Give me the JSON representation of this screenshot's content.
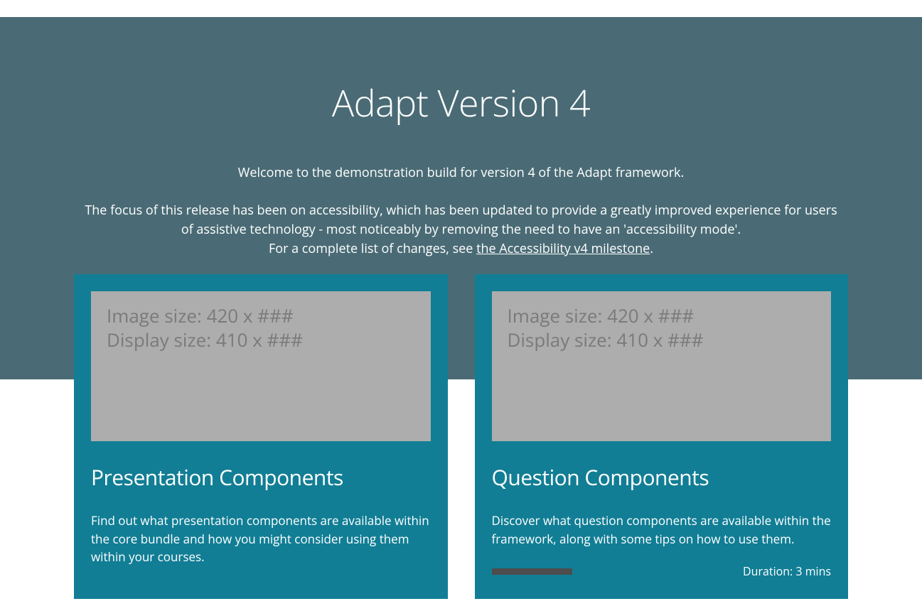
{
  "hero": {
    "title": "Adapt Version 4",
    "intro": "Welcome to the demonstration build for version 4 of the Adapt framework.",
    "body_line1": "The focus of this release has been on accessibility, which has been updated to provide a greatly improved experience for users of assistive technology - most noticeably by removing the need to have an 'accessibility mode'.",
    "body_line2_prefix": "For a complete list of changes, see ",
    "body_link_text": "the Accessibility v4 milestone",
    "body_line2_suffix": "."
  },
  "cards": [
    {
      "image_line1": "Image size: 420 x ###",
      "image_line2": "Display size: 410 x ###",
      "title": "Presentation Components",
      "description": "Find out what presentation components are available within the core bundle and how you might consider using them within your courses."
    },
    {
      "image_line1": "Image size: 420 x ###",
      "image_line2": "Display size: 410 x ###",
      "title": "Question Components",
      "description": "Discover what question components are available within the framework, along with some tips on how to use them.",
      "duration": "Duration: 3 mins"
    }
  ]
}
